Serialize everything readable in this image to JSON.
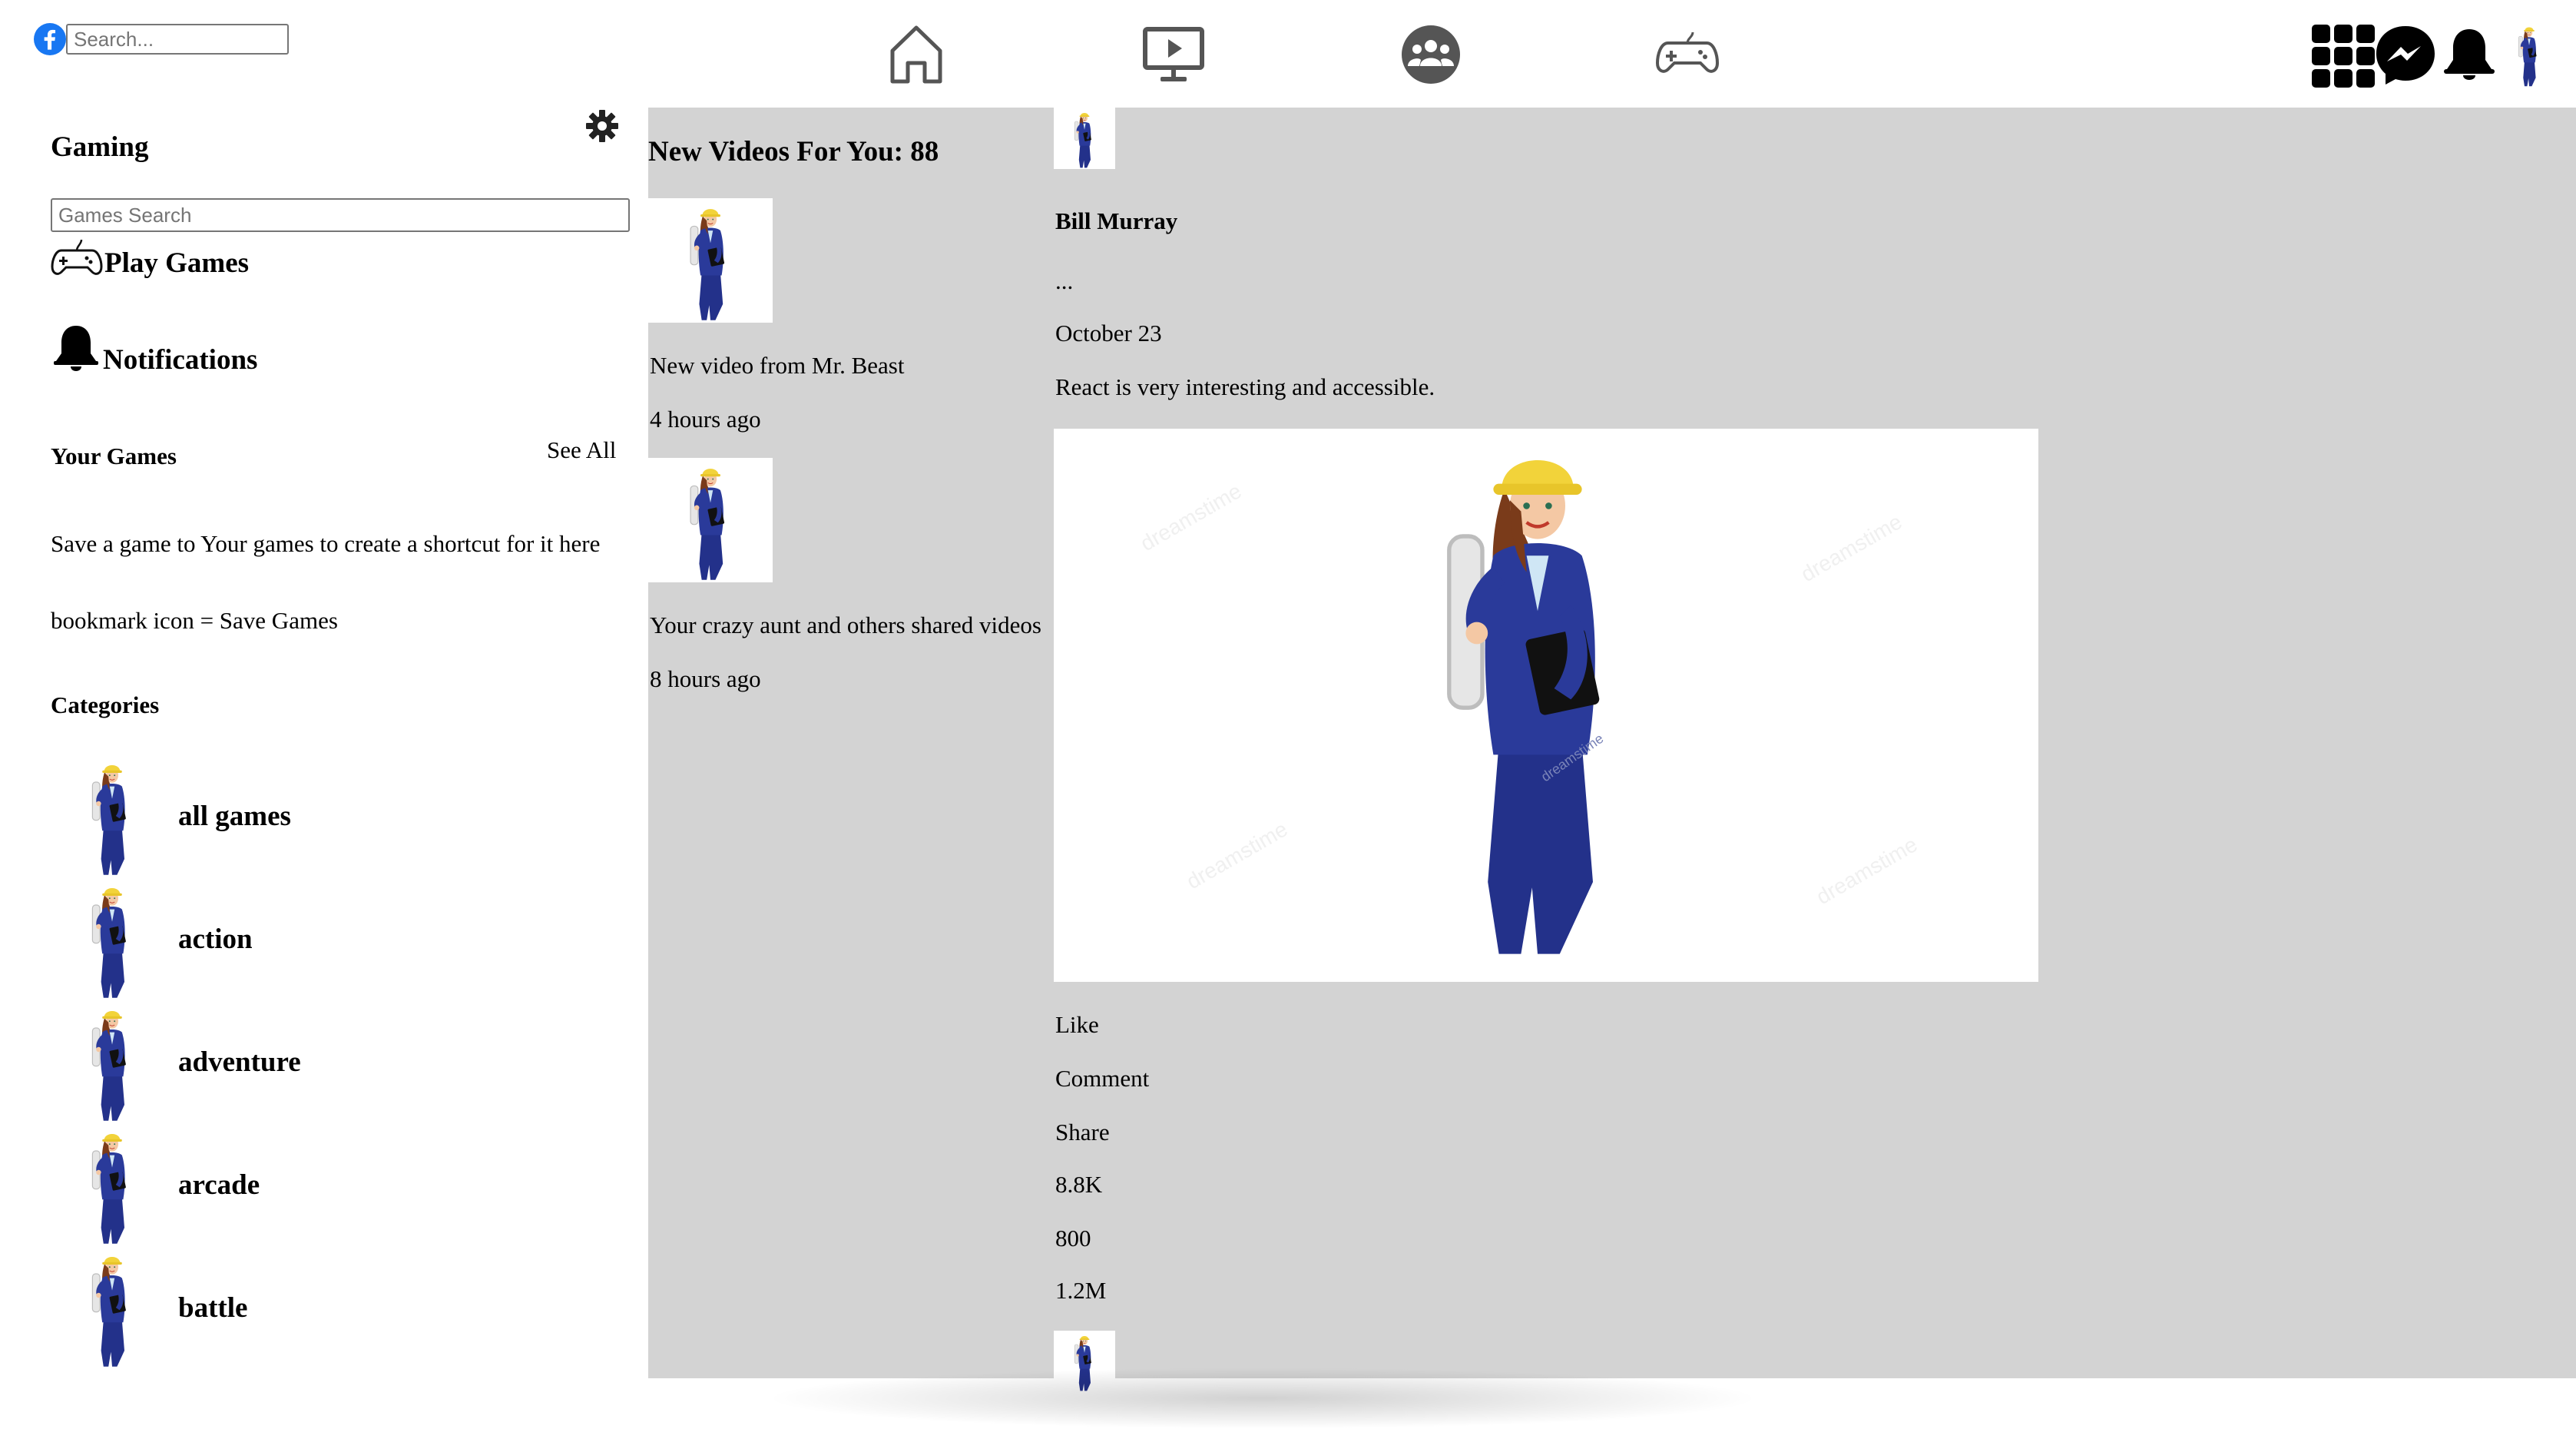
{
  "header": {
    "search_placeholder": "Search..."
  },
  "sidebar": {
    "title": "Gaming",
    "games_search_placeholder": "Games Search",
    "menu": [
      {
        "label": "Play Games",
        "icon": "gamepad-icon"
      },
      {
        "label": "Notifications",
        "icon": "bell-icon"
      }
    ],
    "your_games_title": "Your Games",
    "see_all_label": "See All",
    "save_hint": "Save a game to Your games to create a shortcut for it here",
    "bookmark_hint": "bookmark icon = Save Games",
    "categories_title": "Categories",
    "categories": [
      "all games",
      "action",
      "adventure",
      "arcade",
      "battle"
    ]
  },
  "videos": {
    "title": "New Videos For You: 88",
    "items": [
      {
        "title": "New video from Mr. Beast",
        "time": "4 hours ago"
      },
      {
        "title": "Your crazy aunt and others shared videos",
        "time": "8 hours ago"
      }
    ]
  },
  "post": {
    "author": "Bill Murray",
    "menu": "...",
    "date": "October 23",
    "text": "React is very interesting and accessible.",
    "like_label": "Like",
    "comment_label": "Comment",
    "share_label": "Share",
    "likes_count": "8.8K",
    "comments_count": "800",
    "shares_count": "1.2M",
    "image_watermark": "dreamstime"
  },
  "colors": {
    "main_bg": "#d3d3d3",
    "facebook_blue": "#1877f2",
    "suit_navy": "#23318a",
    "helmet_yellow": "#f2d33a"
  }
}
